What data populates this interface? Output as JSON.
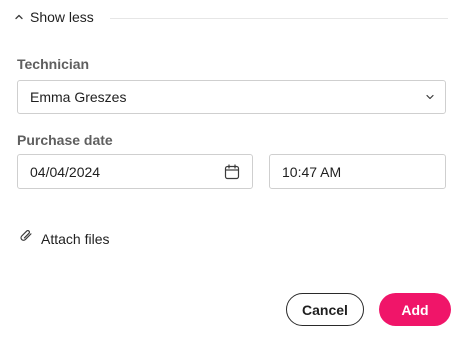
{
  "toggle": {
    "label": "Show less",
    "icon": "chevron-up-icon"
  },
  "technician": {
    "label": "Technician",
    "value": "Emma Greszes",
    "icon": "chevron-down-icon"
  },
  "purchase": {
    "label": "Purchase date",
    "date": "04/04/2024",
    "date_icon": "calendar-icon",
    "time": "10:47 AM"
  },
  "attach": {
    "label": "Attach files",
    "icon": "paperclip-icon"
  },
  "actions": {
    "cancel_label": "Cancel",
    "add_label": "Add"
  },
  "colors": {
    "accent": "#f01569",
    "border": "#cfcfcf",
    "label": "#5f5f5f"
  }
}
